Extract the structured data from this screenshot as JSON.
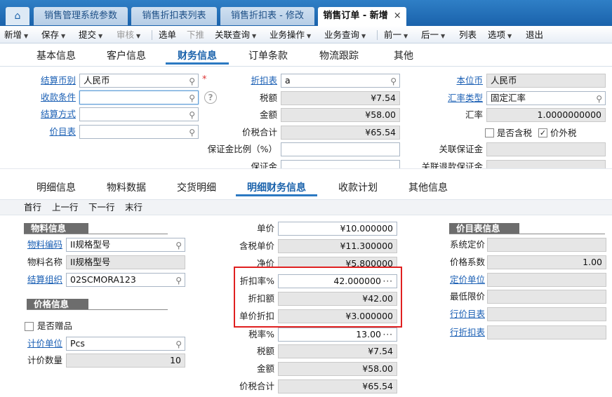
{
  "tabs": [
    {
      "label": "销售管理系统参数"
    },
    {
      "label": "销售折扣表列表"
    },
    {
      "label": "销售折扣表 - 修改"
    },
    {
      "label": "销售订单 - 新增",
      "close": "×"
    }
  ],
  "toolbar": {
    "new": "新增",
    "save": "保存",
    "submit": "提交",
    "audit": "审核",
    "push": "选单",
    "pull": "下推",
    "related": "关联查询",
    "bizop": "业务操作",
    "query": "业务查询",
    "prev": "前一",
    "next": "后一",
    "list": "列表",
    "options": "选项",
    "exit": "退出"
  },
  "section_tabs": [
    "基本信息",
    "客户信息",
    "财务信息",
    "订单条款",
    "物流跟踪",
    "其他"
  ],
  "finance": {
    "currency_label": "结算币别",
    "currency": "人民币",
    "collect_label": "收款条件",
    "collect": "",
    "settle_label": "结算方式",
    "settle": "",
    "price_list_label": "价目表",
    "price_list": "",
    "discount_list_label": "折扣表",
    "discount_list": "a",
    "tax_label": "税额",
    "tax": "¥7.54",
    "amount_label": "金额",
    "amount": "¥58.00",
    "total_label": "价税合计",
    "total": "¥65.54",
    "deposit_ratio_label": "保证金比例（%）",
    "deposit_ratio": "",
    "deposit_label": "保证金",
    "base_currency_label": "本位币",
    "base_currency": "人民币",
    "rate_type_label": "汇率类型",
    "rate_type": "固定汇率",
    "rate_label": "汇率",
    "rate": "1.0000000000",
    "tax_incl_label": "是否含税",
    "tax_incl": false,
    "tax_excl_label": "价外税",
    "tax_excl": true,
    "rel_deposit_label": "关联保证金",
    "rel_refund_label": "关联退款保证金"
  },
  "detail_tabs": [
    "明细信息",
    "物料数据",
    "交货明细",
    "明细财务信息",
    "收款计划",
    "其他信息"
  ],
  "nav": {
    "first": "首行",
    "prev": "上一行",
    "next": "下一行",
    "last": "末行"
  },
  "material": {
    "group": "物料信息",
    "code_label": "物料编码",
    "code": "II规格型号",
    "name_label": "物料名称",
    "name": "II规格型号",
    "org_label": "结算组织",
    "org": "02SCMORA123"
  },
  "price_group": {
    "group": "价格信息",
    "gift_label": "是否赠品",
    "gift": false,
    "unit_label": "计价单位",
    "unit": "Pcs",
    "qty_label": "计价数量",
    "qty": "10"
  },
  "detail_fin": {
    "price_label": "单价",
    "price": "¥10.000000",
    "tax_price_label": "含税单价",
    "tax_price": "¥11.300000",
    "net_price_label": "净价",
    "net_price": "¥5.800000",
    "disc_rate_label": "折扣率%",
    "disc_rate": "42.000000",
    "disc_amt_label": "折扣额",
    "disc_amt": "¥42.00",
    "unit_disc_label": "单价折扣",
    "unit_disc": "¥3.000000",
    "tax_rate_label": "税率%",
    "tax_rate": "13.00",
    "tax_label": "税额",
    "tax": "¥7.54",
    "amount_label": "金额",
    "amount": "¥58.00",
    "total_label": "价税合计",
    "total": "¥65.54"
  },
  "pricelist_info": {
    "group": "价目表信息",
    "sys_price_label": "系统定价",
    "sys_price": "",
    "coef_label": "价格系数",
    "coef": "1.00",
    "pricing_unit_label": "定价单位",
    "pricing_unit": "",
    "min_price_label": "最低限价",
    "min_price": "",
    "row_pricelist_label": "行价目表",
    "row_pricelist": "",
    "row_disclist_label": "行折扣表",
    "row_disclist": ""
  },
  "colors": {
    "accent": "#1a62ab",
    "highlight_box": "#e02020",
    "readonly": "#e6e6e6"
  },
  "icons": {
    "home": "home-icon",
    "lookup": "magnifier-icon",
    "more": "ellipsis-icon",
    "help": "question-icon"
  }
}
